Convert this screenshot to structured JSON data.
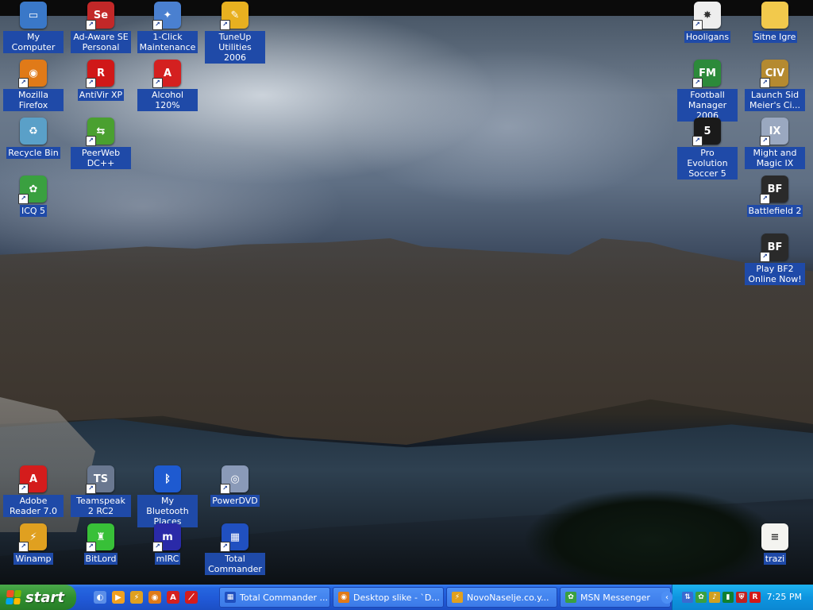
{
  "desktop": {
    "icons": [
      {
        "label": "My Computer",
        "icon": "my-computer-icon",
        "color": "#3a78c8",
        "glyph": "▭",
        "shortcut": false
      },
      {
        "label": "Ad-Aware SE Personal",
        "icon": "ad-aware-icon",
        "color": "#c22828",
        "glyph": "Se",
        "shortcut": true
      },
      {
        "label": "1-Click Maintenance",
        "icon": "maintenance-icon",
        "color": "#4a80d0",
        "glyph": "✦",
        "shortcut": true
      },
      {
        "label": "TuneUp Utilities 2006",
        "icon": "tuneup-icon",
        "color": "#e8b020",
        "glyph": "✎",
        "shortcut": true
      },
      {
        "label": "Hooligans",
        "icon": "hooligans-icon",
        "color": "#eeeeee",
        "glyph": "✸",
        "shortcut": true
      },
      {
        "label": "Sitne Igre",
        "icon": "folder-icon",
        "color": "#f2c94c",
        "glyph": "",
        "shortcut": false
      },
      {
        "label": "Mozilla Firefox",
        "icon": "firefox-icon",
        "color": "#e07a18",
        "glyph": "◉",
        "shortcut": true
      },
      {
        "label": "AntiVir XP",
        "icon": "antivir-icon",
        "color": "#d01818",
        "glyph": "R",
        "shortcut": true
      },
      {
        "label": "Alcohol 120%",
        "icon": "alcohol-icon",
        "color": "#d42020",
        "glyph": "A",
        "shortcut": true
      },
      {
        "label": "Football Manager 2006",
        "icon": "football-manager-icon",
        "color": "#2c8a3a",
        "glyph": "FM",
        "shortcut": true
      },
      {
        "label": "Launch Sid Meier's Ci...",
        "icon": "civilization-icon",
        "color": "#b58a30",
        "glyph": "CIV",
        "shortcut": true
      },
      {
        "label": "Recycle Bin",
        "icon": "recycle-bin-icon",
        "color": "#5aa0c8",
        "glyph": "♻",
        "shortcut": false
      },
      {
        "label": "PeerWeb DC++",
        "icon": "peerweb-icon",
        "color": "#4aa030",
        "glyph": "⇆",
        "shortcut": true
      },
      {
        "label": "Pro Evolution Soccer 5",
        "icon": "pes5-icon",
        "color": "#1a1a1a",
        "glyph": "5",
        "shortcut": true
      },
      {
        "label": "Might and Magic IX",
        "icon": "might-magic-icon",
        "color": "#9aa8c0",
        "glyph": "IX",
        "shortcut": true
      },
      {
        "label": "ICQ 5",
        "icon": "icq-icon",
        "color": "#3aa040",
        "glyph": "✿",
        "shortcut": true
      },
      {
        "label": "Battlefield 2",
        "icon": "battlefield-icon",
        "color": "#2a2a2a",
        "glyph": "BF",
        "shortcut": true
      },
      {
        "label": "Play BF2 Online Now!",
        "icon": "bf2-online-icon",
        "color": "#2a2a2a",
        "glyph": "BF",
        "shortcut": true
      },
      {
        "label": "Adobe Reader 7.0",
        "icon": "adobe-reader-icon",
        "color": "#d41c1c",
        "glyph": "A",
        "shortcut": true
      },
      {
        "label": "Teamspeak 2 RC2",
        "icon": "teamspeak-icon",
        "color": "#6a7890",
        "glyph": "TS",
        "shortcut": true
      },
      {
        "label": "My Bluetooth Places",
        "icon": "bluetooth-icon",
        "color": "#1e5ad0",
        "glyph": "ᛒ",
        "shortcut": false
      },
      {
        "label": "PowerDVD",
        "icon": "powerdvd-icon",
        "color": "#8a9ab8",
        "glyph": "◎",
        "shortcut": true
      },
      {
        "label": "Winamp",
        "icon": "winamp-icon",
        "color": "#e0a020",
        "glyph": "⚡",
        "shortcut": true
      },
      {
        "label": "BitLord",
        "icon": "bitlord-icon",
        "color": "#38c038",
        "glyph": "♜",
        "shortcut": true
      },
      {
        "label": "mIRC",
        "icon": "mirc-icon",
        "color": "#2a2aa8",
        "glyph": "m",
        "shortcut": true
      },
      {
        "label": "Total Commander",
        "icon": "total-commander-icon",
        "color": "#2050c0",
        "glyph": "▦",
        "shortcut": true
      },
      {
        "label": "trazi",
        "icon": "text-file-icon",
        "color": "#f4f4f0",
        "glyph": "≡",
        "shortcut": false
      }
    ]
  },
  "taskbar": {
    "start_label": "start",
    "quick_launch": [
      {
        "icon": "show-desktop-icon",
        "color": "#5b8ee8",
        "glyph": "◐"
      },
      {
        "icon": "media-player-icon",
        "color": "#f0a020",
        "glyph": "▶"
      },
      {
        "icon": "winamp-icon",
        "color": "#e0a020",
        "glyph": "⚡"
      },
      {
        "icon": "firefox-icon",
        "color": "#e07a18",
        "glyph": "◉"
      },
      {
        "icon": "alcohol-icon",
        "color": "#d42020",
        "glyph": "A"
      },
      {
        "icon": "adobe-reader-icon",
        "color": "#d41c1c",
        "glyph": "⟋"
      }
    ],
    "tasks": [
      {
        "label": "Total Commander ...",
        "icon": "total-commander-icon",
        "color": "#2050c0",
        "glyph": "▦"
      },
      {
        "label": "Desktop slike - `D...",
        "icon": "firefox-icon",
        "color": "#e07a18",
        "glyph": "◉"
      },
      {
        "label": "NovoNaselje.co.y...",
        "icon": "winamp-icon",
        "color": "#e0a020",
        "glyph": "⚡"
      },
      {
        "label": "MSN Messenger",
        "icon": "msn-messenger-icon",
        "color": "#3aa040",
        "glyph": "✿"
      }
    ],
    "tray": [
      {
        "icon": "network-icon",
        "color": "#3a6ad0",
        "glyph": "⇅"
      },
      {
        "icon": "msn-tray-icon",
        "color": "#3aa040",
        "glyph": "✿"
      },
      {
        "icon": "volume-icon",
        "color": "#d0a020",
        "glyph": "♪"
      },
      {
        "icon": "bar-meter-icon",
        "color": "#108030",
        "glyph": "▮"
      },
      {
        "icon": "shield-icon",
        "color": "#c02020",
        "glyph": "⛨"
      },
      {
        "icon": "antivir-tray-icon",
        "color": "#d01818",
        "glyph": "R"
      }
    ],
    "clock": "7:25 PM",
    "tray_toggle": "‹"
  }
}
